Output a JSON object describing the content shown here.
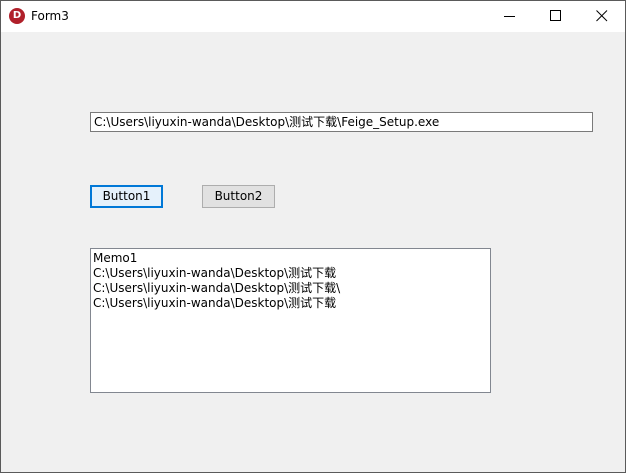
{
  "window": {
    "title": "Form3",
    "icon_letter": "D",
    "controls": {
      "minimize": "minimize-icon",
      "maximize": "maximize-icon",
      "close": "close-icon"
    }
  },
  "edit": {
    "value": "C:\\Users\\liyuxin-wanda\\Desktop\\测试下载\\Feige_Setup.exe"
  },
  "buttons": {
    "button1": "Button1",
    "button2": "Button2"
  },
  "memo": {
    "lines": [
      "Memo1",
      "C:\\Users\\liyuxin-wanda\\Desktop\\测试下载",
      "C:\\Users\\liyuxin-wanda\\Desktop\\测试下载\\",
      "C:\\Users\\liyuxin-wanda\\Desktop\\测试下载"
    ]
  },
  "colors": {
    "icon_red": "#b0202a",
    "focus_blue": "#0078d7",
    "form_bg": "#f0f0f0"
  }
}
